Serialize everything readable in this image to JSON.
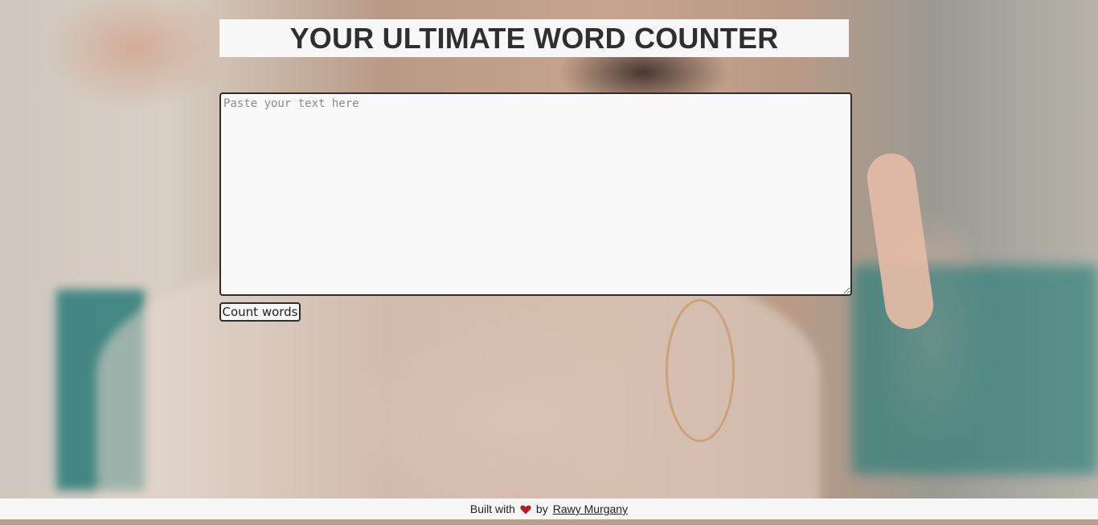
{
  "header": {
    "title": "YOUR ULTIMATE WORD COUNTER"
  },
  "editor": {
    "placeholder": "Paste your text here",
    "value": ""
  },
  "actions": {
    "count_label": "Count words"
  },
  "footer": {
    "built_with": "Built with",
    "heart_icon": "heart-icon",
    "heart_color": "#b21e1e",
    "by": "by",
    "author": "Rawy Murgany"
  }
}
